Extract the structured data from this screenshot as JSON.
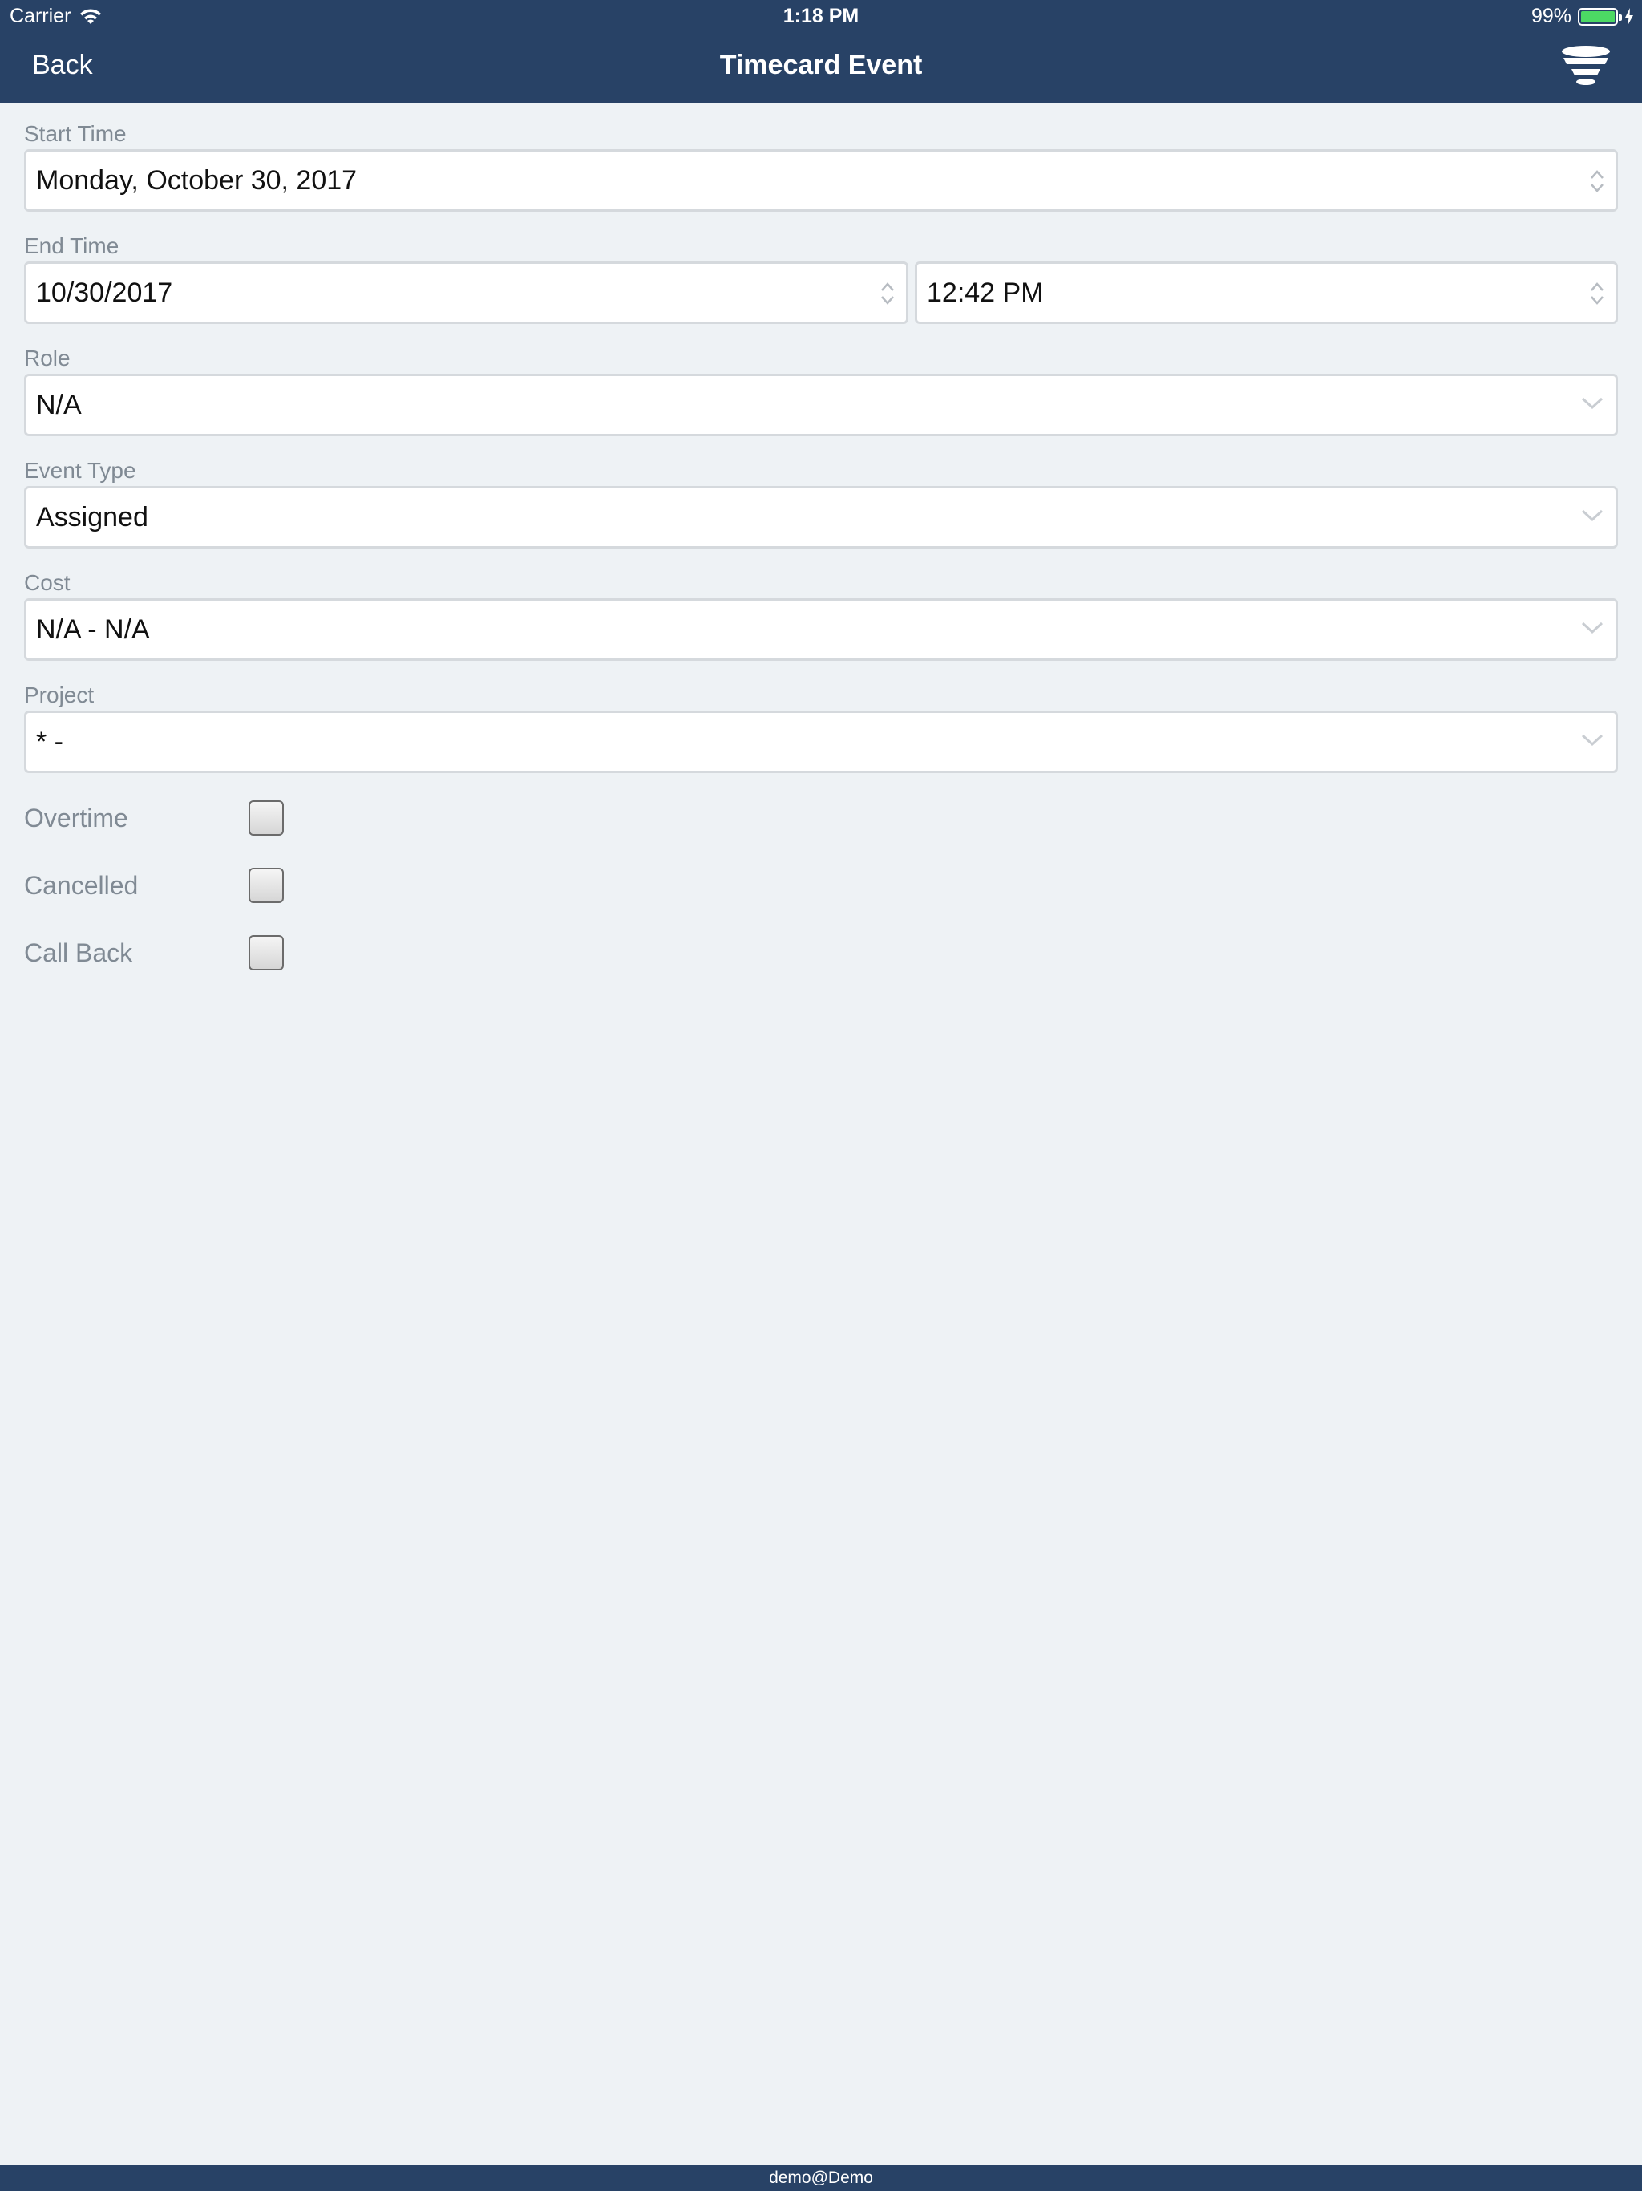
{
  "status_bar": {
    "carrier": "Carrier",
    "time": "1:18 PM",
    "battery_percent": "99%",
    "battery_level": 0.99,
    "battery_color": "#4cd964"
  },
  "nav": {
    "back_label": "Back",
    "title": "Timecard Event",
    "menu_icon": "stack-layers-icon"
  },
  "form": {
    "start_time": {
      "label": "Start Time",
      "value": "Monday, October 30, 2017"
    },
    "end_time": {
      "label": "End Time",
      "date_value": "10/30/2017",
      "time_value": "12:42 PM"
    },
    "role": {
      "label": "Role",
      "value": "N/A"
    },
    "event_type": {
      "label": "Event Type",
      "value": "Assigned"
    },
    "cost": {
      "label": "Cost",
      "value": "N/A - N/A"
    },
    "project": {
      "label": "Project",
      "value": "* -"
    },
    "checkboxes": [
      {
        "label": "Overtime",
        "checked": false
      },
      {
        "label": "Cancelled",
        "checked": false
      },
      {
        "label": "Call Back",
        "checked": false
      }
    ]
  },
  "footer": {
    "user": "demo@Demo"
  },
  "colors": {
    "header_bg": "#284266",
    "page_bg": "#eef2f5",
    "label_text": "#808a94"
  }
}
